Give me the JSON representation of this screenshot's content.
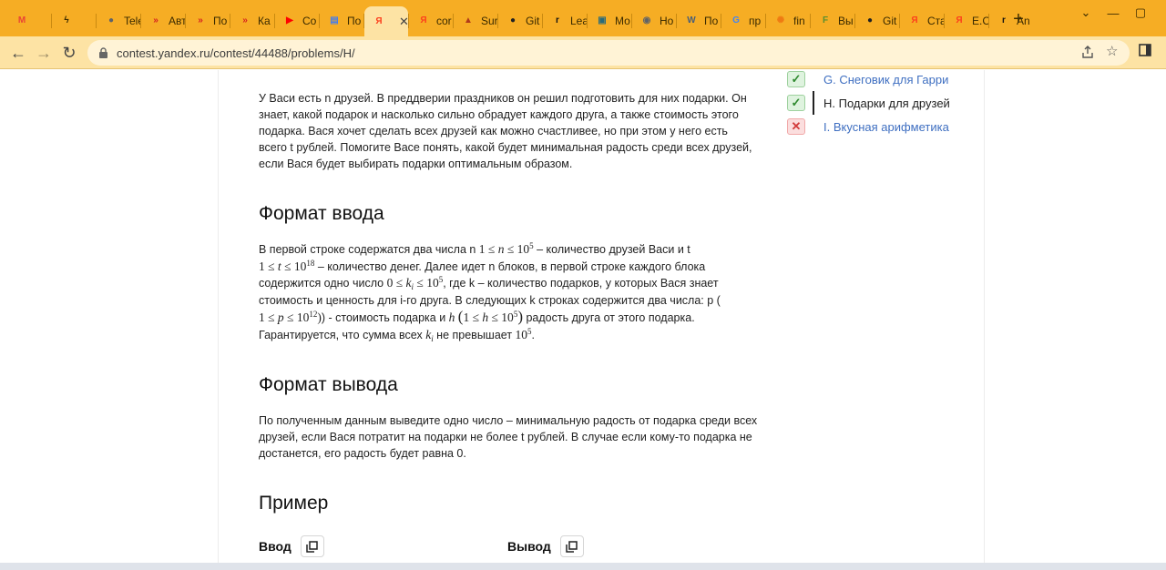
{
  "browser": {
    "tabs": [
      {
        "label": "",
        "icon": "gmail-icon",
        "color": "#ea4335",
        "glyph": "M"
      },
      {
        "label": "",
        "icon": "bolt-icon",
        "color": "#3a2a00",
        "glyph": "ϟ"
      },
      {
        "label": "Tele",
        "icon": "globe-icon",
        "color": "#5f6368",
        "glyph": "●"
      },
      {
        "label": "Авт",
        "icon": "yandex-practicum-icon",
        "color": "#d62020",
        "glyph": "»"
      },
      {
        "label": "По",
        "icon": "yandex-practicum-icon",
        "color": "#d62020",
        "glyph": "»"
      },
      {
        "label": "Ка",
        "icon": "yandex-practicum-icon",
        "color": "#d62020",
        "glyph": "»"
      },
      {
        "label": "Со",
        "icon": "youtube-icon",
        "color": "#ff0000",
        "glyph": "▶"
      },
      {
        "label": "По",
        "icon": "document-icon",
        "color": "#4a7ee8",
        "glyph": "▤"
      },
      {
        "label": "",
        "icon": "yandex-icon",
        "color": "#fc3f1d",
        "glyph": "Я",
        "active": true
      },
      {
        "label": "cor",
        "icon": "yandex-icon",
        "color": "#fc3f1d",
        "glyph": "Я"
      },
      {
        "label": "Sur",
        "icon": "image-icon",
        "color": "#b03a1a",
        "glyph": "▲"
      },
      {
        "label": "Git",
        "icon": "github-icon",
        "color": "#222222",
        "glyph": "●"
      },
      {
        "label": "Lea",
        "icon": "leetcode-icon",
        "color": "#111111",
        "glyph": "r"
      },
      {
        "label": "Мо",
        "icon": "monitor-icon",
        "color": "#2a6b7a",
        "glyph": "▣"
      },
      {
        "label": "Но",
        "icon": "chrome-icon",
        "color": "#5f6368",
        "glyph": "◉"
      },
      {
        "label": "По",
        "icon": "wordpress-icon",
        "color": "#4a5f78",
        "glyph": "W"
      },
      {
        "label": "пр",
        "icon": "google-icon",
        "color": "#4285f4",
        "glyph": "G"
      },
      {
        "label": "fin",
        "icon": "sun-icon",
        "color": "#ef7a12",
        "glyph": "✺"
      },
      {
        "label": "Вы",
        "icon": "sheet-icon",
        "color": "#5a8f2e",
        "glyph": "F"
      },
      {
        "label": "Git",
        "icon": "github-icon",
        "color": "#222222",
        "glyph": "●"
      },
      {
        "label": "Ста",
        "icon": "yandex-icon",
        "color": "#fc3f1d",
        "glyph": "Я"
      },
      {
        "label": "Е.С",
        "icon": "yandex-icon",
        "color": "#fc3f1d",
        "glyph": "Я"
      },
      {
        "label": "An",
        "icon": "leetcode-icon",
        "color": "#111111",
        "glyph": "r"
      }
    ],
    "url": "contest.yandex.ru/contest/44488/problems/H/"
  },
  "problem": {
    "intro": "У Васи есть n друзей. В преддверии праздников он решил подготовить для них подарки. Он знает, какой подарок и насколько сильно обрадует каждого друга, а также стоимость этого подарка. Вася хочет сделать всех друзей как можно счастливее, но при этом у него есть всего t рублей. Помогите Васе понять, какой будет минимальная радость среди всех друзей, если Вася будет выбирать подарки оптимальным образом.",
    "input_heading": "Формат ввода",
    "input": {
      "t1": "В первой строке содержатся два числа n ",
      "t2": " – количество друзей Васи и t",
      "t3": " – количество денег. Далее идет n блоков, в первой строке каждого блока содержится одно число ",
      "t4": ", где k – количество подарков, у которых Вася знает стоимость и ценность для i-го друга. В следующих k строках содержится два числа: p (",
      "t5": ") - стоимость подарка и ",
      "t6": " радость друга от этого подарка.",
      "t7": "Гарантируется, что сумма всех ",
      "t8": " не превышает ",
      "t9": "."
    },
    "output_heading": "Формат вывода",
    "output": "По полученным данным выведите одно число – минимальную радость от подарка среди всех друзей, если Вася потратит на подарки не более t рублей. В случае если кому-то подарка не достанется, его радость будет равна 0.",
    "example_heading": "Пример",
    "example_input_label": "Ввод",
    "example_output_label": "Вывод"
  },
  "problems_list": [
    {
      "label": "G. Снеговик для Гарри",
      "status": "ok",
      "status_glyph": "✓"
    },
    {
      "label": "H. Подарки для друзей",
      "status": "ok",
      "status_glyph": "✓",
      "current": true
    },
    {
      "label": "I. Вкусная арифметика",
      "status": "fail",
      "status_glyph": "✕"
    }
  ],
  "colors": {
    "tabstrip": "#f6ad24",
    "toolbar": "#fde3a4",
    "link": "#3f6fc1",
    "ok": "#2f8a2f",
    "fail": "#d23b3b"
  }
}
